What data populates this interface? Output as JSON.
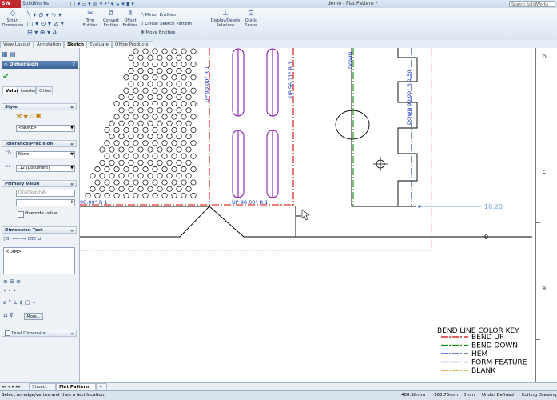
{
  "titlebar": {
    "app_logo": "SW",
    "app_name": "SolidWorks",
    "document_title": "demo - Flat Pattern *",
    "search_placeholder": "Search SolidWorks"
  },
  "command_manager": {
    "smart_dimension": "Smart Dimension",
    "trim_entities": "Trim Entities",
    "convert_entities": "Convert Entities",
    "offset_entities": "Offset Entities",
    "mirror_entities": "Mirror Entities",
    "linear_sketch_pattern": "Linear Sketch Pattern",
    "move_entities": "Move Entities",
    "display_delete_relations": "Display/Delete Relations",
    "quick_snaps": "Quick Snaps"
  },
  "tabs": [
    "View Layout",
    "Annotation",
    "Sketch",
    "Evaluate",
    "Office Products"
  ],
  "active_tab": "Sketch",
  "property_manager": {
    "title": "Dimension",
    "subtabs": [
      "Value",
      "Leaders",
      "Other"
    ],
    "style_section": "Style",
    "style_select": "<NONE>",
    "tolerance_section": "Tolerance/Precision",
    "tolerance_select": "None",
    "precision_select": ".12 (Document)",
    "primary_value_section": "Primary Value",
    "primary_value_name": "D2@Sketch99",
    "override_label": "Override value:",
    "dimension_text_section": "Dimension Text",
    "dimension_text_value": "<DIM>",
    "more_button": "More...",
    "dual_dimension_label": "Dual Dimension"
  },
  "drawing": {
    "zone_letters": [
      "D",
      "C",
      "B"
    ],
    "bend_labels": {
      "up_left": "UP 90.00° R 1",
      "up_right": "UP 56.21° R 1",
      "down_top": "DOWN",
      "down_mid": "DOWN 90.00° R 1.50",
      "up_bottom": "UP 90.00° R 1",
      "left_bottom": "90.00° R 1"
    },
    "dimension_value": "18.20",
    "zero_label": "0",
    "legend": {
      "title": "BEND LINE COLOR KEY",
      "items": [
        {
          "label": "BEND UP",
          "color": "#d40000"
        },
        {
          "label": "BEND DOWN",
          "color": "#0a8a0a"
        },
        {
          "label": "HEM",
          "color": "#1030c8"
        },
        {
          "label": "FORM FEATURE",
          "color": "#8a1ab0"
        },
        {
          "label": "BLANK",
          "color": "#e08a00"
        }
      ]
    }
  },
  "sheet_tabs": [
    "Sheet1",
    "Flat Pattern"
  ],
  "status": {
    "message": "Select an edge/vertex and then a text location.",
    "x": "408.38mm",
    "y": "163.75mm",
    "z": "0mm",
    "state": "Under Defined",
    "mode": "Editing Drawing"
  }
}
